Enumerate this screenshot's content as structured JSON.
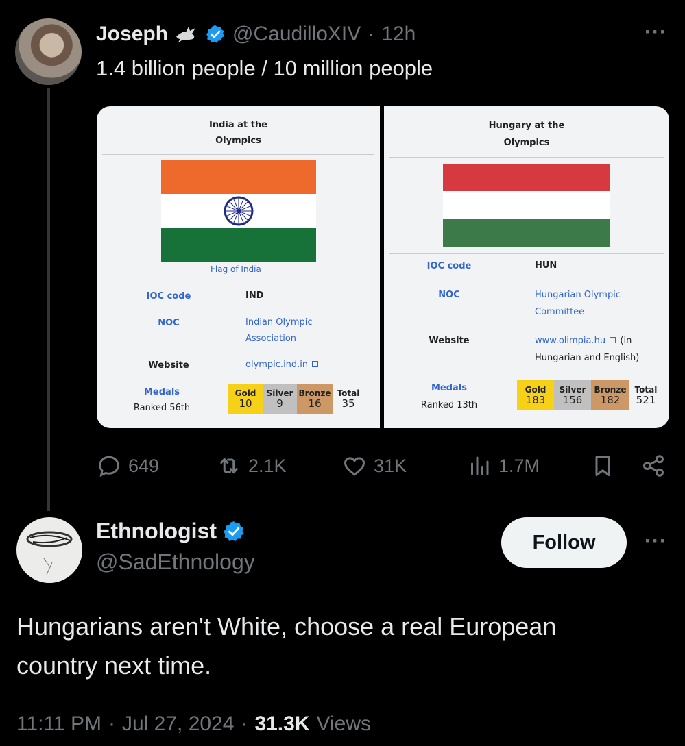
{
  "tweet1": {
    "name": "Joseph",
    "handle": "@CaudilloXIV",
    "time": "12h",
    "separator": "·",
    "text": "1.4 billion people / 10 million people",
    "more": "···"
  },
  "media": {
    "india": {
      "title_line1": "India at the",
      "title_line2": "Olympics",
      "flag_caption": "Flag of India",
      "ioc_label": "IOC code",
      "ioc_value": "IND",
      "noc_label": "NOC",
      "noc_value_line1": "Indian Olympic",
      "noc_value_line2": "Association",
      "website_label": "Website",
      "website_value": "olympic.ind.in",
      "medals_label": "Medals",
      "ranked": "Ranked 56th",
      "gold_label": "Gold",
      "gold": "10",
      "silver_label": "Silver",
      "silver": "9",
      "bronze_label": "Bronze",
      "bronze": "16",
      "total_label": "Total",
      "total": "35",
      "flag_colors": {
        "saffron": "#ed6a2c",
        "white": "#ffffff",
        "green": "#17723a",
        "chakra": "#1d2a87"
      }
    },
    "hungary": {
      "title_line1": "Hungary at the",
      "title_line2": "Olympics",
      "ioc_label": "IOC code",
      "ioc_value": "HUN",
      "noc_label": "NOC",
      "noc_value_line1": "Hungarian Olympic",
      "noc_value_line2": "Committee",
      "website_label": "Website",
      "website_value_line1": "www.olimpia.hu",
      "website_value_line1_suffix": "(in",
      "website_value_line2": "Hungarian and English)",
      "medals_label": "Medals",
      "ranked": "Ranked 13th",
      "gold_label": "Gold",
      "gold": "183",
      "silver_label": "Silver",
      "silver": "156",
      "bronze_label": "Bronze",
      "bronze": "182",
      "total_label": "Total",
      "total": "521",
      "flag_colors": {
        "red": "#d6393f",
        "white": "#ffffff",
        "green": "#3d7a4a"
      }
    }
  },
  "actions": {
    "replies": "649",
    "reposts": "2.1K",
    "likes": "31K",
    "views": "1.7M"
  },
  "tweet2": {
    "name": "Ethnologist",
    "handle": "@SadEthnology",
    "follow_label": "Follow",
    "more": "···",
    "text_line1": "Hungarians aren't White, choose a real European",
    "text_line2": "country next time."
  },
  "meta": {
    "time": "11:11 PM",
    "date": "Jul 27, 2024",
    "views_count": "31.3K",
    "views_label": "Views",
    "separator": "·"
  },
  "colors": {
    "background": "#000000",
    "text": "#e7e9ea",
    "muted": "#71767b",
    "verified": "#1d9bf0",
    "link": "#3366cc"
  }
}
